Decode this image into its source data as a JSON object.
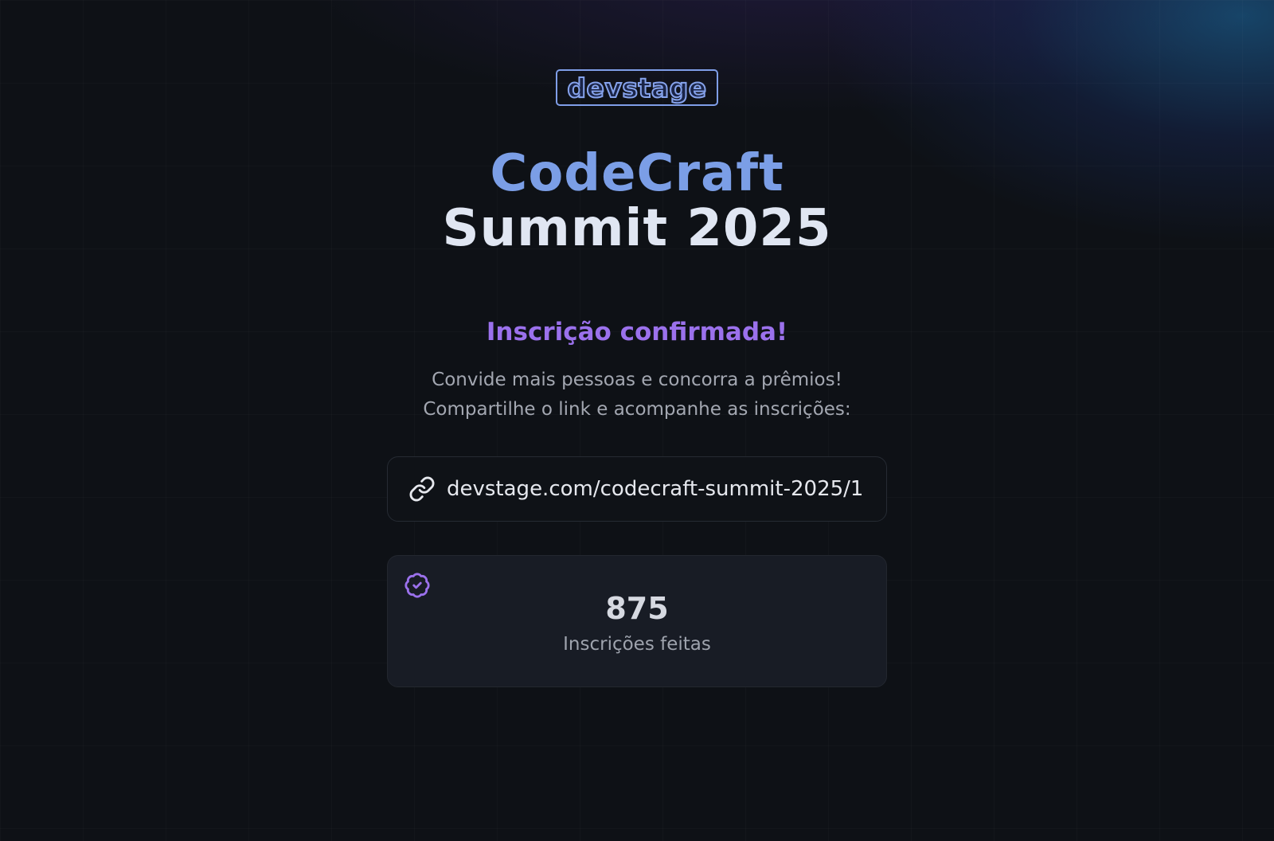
{
  "logo": {
    "text": "devstage"
  },
  "event": {
    "title_line1": "CodeCraft",
    "title_line2": "Summit 2025"
  },
  "confirmation": {
    "heading": "Inscrição confirmada!",
    "subtitle_line1": "Convide mais pessoas e concorra a prêmios!",
    "subtitle_line2": "Compartilhe o link e acompanhe as inscrições:"
  },
  "invite_link": {
    "icon": "link-icon",
    "url": "devstage.com/codecraft-summit-2025/1"
  },
  "stats": {
    "icon": "badge-check-icon",
    "value": "875",
    "label": "Inscrições feitas"
  },
  "colors": {
    "accent_blue": "#7b9ee6",
    "accent_purple": "#9b71ec",
    "background": "#0e1116",
    "card": "#181c25"
  }
}
